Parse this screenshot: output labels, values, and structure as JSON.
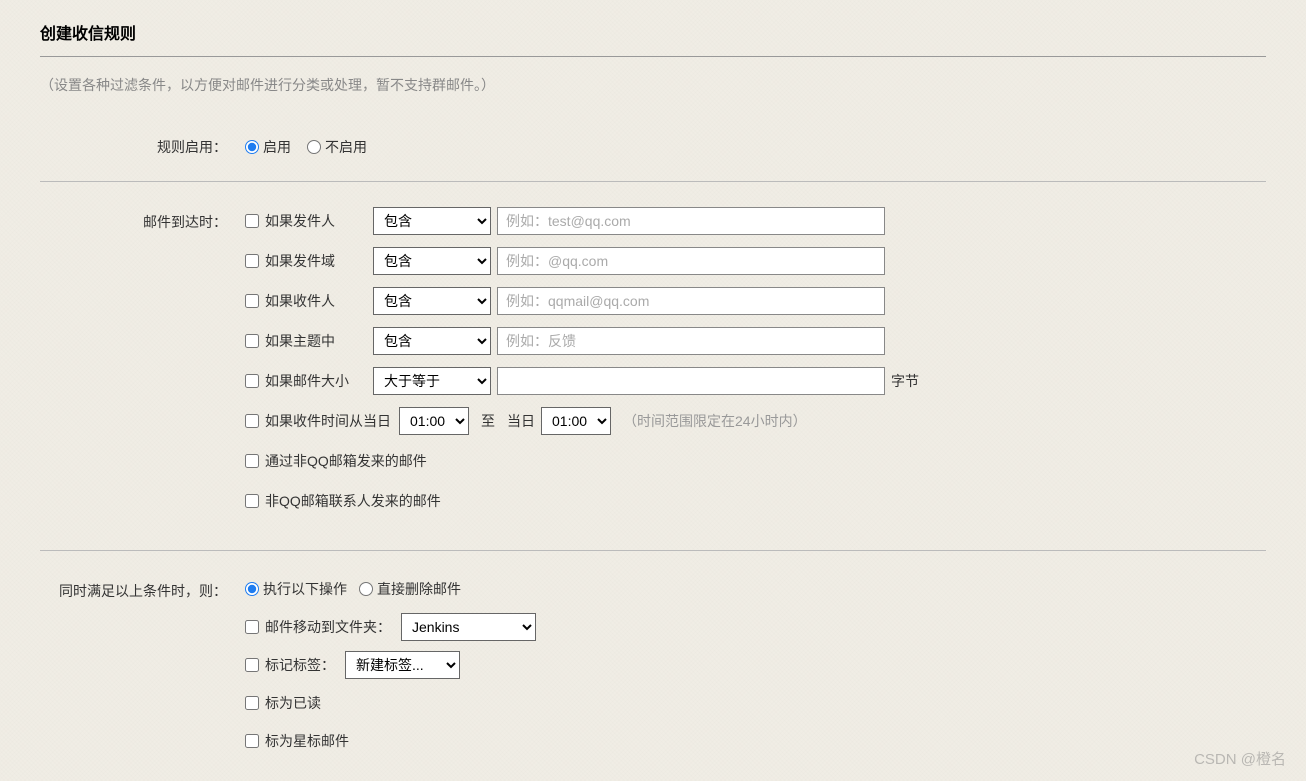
{
  "page": {
    "title": "创建收信规则",
    "subtitle": "（设置各种过滤条件，以方便对邮件进行分类或处理，暂不支持群邮件。）"
  },
  "ruleEnable": {
    "label": "规则启用：",
    "options": {
      "enable": "启用",
      "disable": "不启用"
    }
  },
  "arrival": {
    "label": "邮件到达时：",
    "conditions": {
      "sender": {
        "label": "如果发件人",
        "op": "包含",
        "placeholder": "例如：test@qq.com"
      },
      "domain": {
        "label": "如果发件域",
        "op": "包含",
        "placeholder": "例如：@qq.com"
      },
      "recipient": {
        "label": "如果收件人",
        "op": "包含",
        "placeholder": "例如：qqmail@qq.com"
      },
      "subject": {
        "label": "如果主题中",
        "op": "包含",
        "placeholder": "例如：反馈"
      },
      "size": {
        "label": "如果邮件大小",
        "op": "大于等于",
        "unit": "字节"
      },
      "timeRange": {
        "prefix": "如果收件时间从当日",
        "fromTime": "01:00",
        "toLabel": "至",
        "toDayLabel": "当日",
        "toTime": "01:00",
        "hint": "（时间范围限定在24小时内）"
      },
      "nonQQSender": "通过非QQ邮箱发来的邮件",
      "nonQQContact": "非QQ邮箱联系人发来的邮件"
    }
  },
  "actions": {
    "label": "同时满足以上条件时，则：",
    "modeOptions": {
      "execute": "执行以下操作",
      "delete": "直接删除邮件"
    },
    "moveToFolder": {
      "label": "邮件移动到文件夹：",
      "value": "Jenkins"
    },
    "tagLabel": {
      "label": "标记标签：",
      "value": "新建标签..."
    },
    "markRead": "标为已读",
    "markStar": "标为星标邮件"
  },
  "watermark": "CSDN @橙名"
}
